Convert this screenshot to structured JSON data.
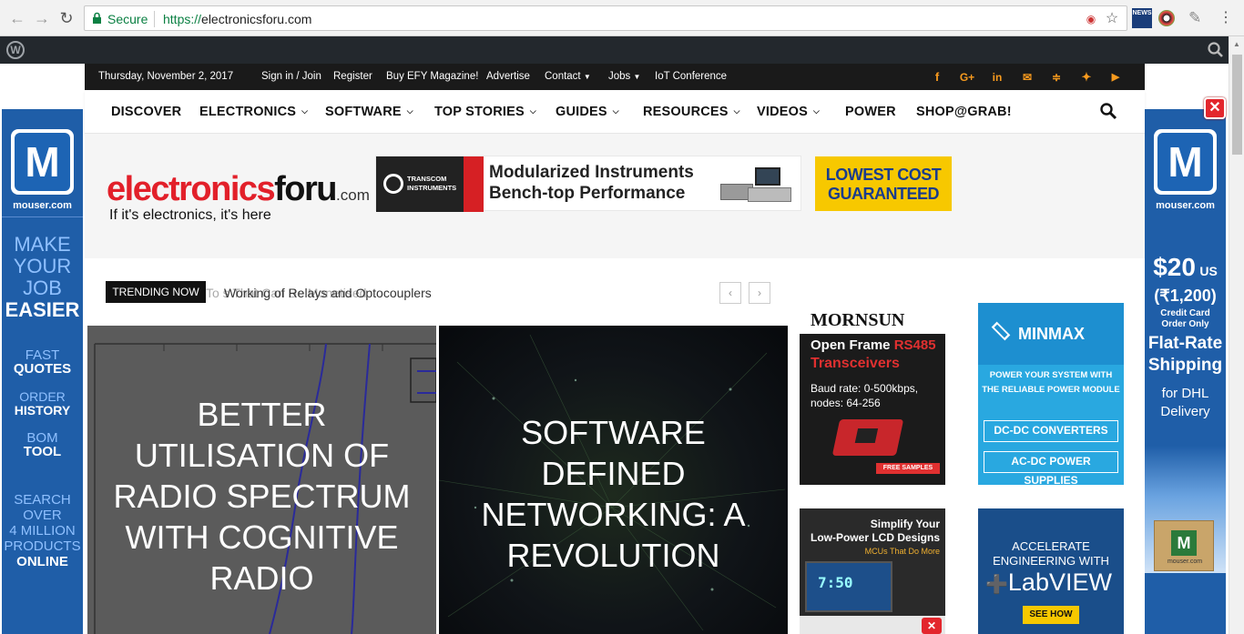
{
  "browser": {
    "secure_label": "Secure",
    "url_scheme": "https://",
    "url_host": "electronicsforu.com"
  },
  "topbar": {
    "date": "Thursday, November 2, 2017",
    "links": [
      "Sign in / Join",
      "Register",
      "Buy EFY Magazine!",
      "Advertise",
      "Contact",
      "Jobs",
      "IoT Conference"
    ]
  },
  "nav": {
    "items": [
      "DISCOVER",
      "ELECTRONICS",
      "SOFTWARE",
      "TOP STORIES",
      "GUIDES",
      "RESOURCES",
      "VIDEOS",
      "POWER",
      "SHOP@GRAB!"
    ]
  },
  "logo": {
    "red": "electronics",
    "black": "foru",
    "com": ".com",
    "tagline": "If it's electronics, it's here"
  },
  "ads": {
    "transcom": {
      "brand_1": "TRANSCOM",
      "brand_2": "INSTRUMENTS",
      "line1": "Modularized Instruments",
      "line2": "Bench-top Performance"
    },
    "lowcost": {
      "line1": "LOWEST COST",
      "line2": "GUARANTEED"
    },
    "mornsun": {
      "brand": "MORNSUN",
      "l1a": "Open Frame ",
      "l1b": "RS485",
      "l2": "Transceivers",
      "l3": "Baud rate: 0-500kbps,",
      "l4": "nodes: 64-256",
      "badge": "FREE SAMPLES"
    },
    "minmax": {
      "brand": "MINMAX",
      "l1": "POWER YOUR SYSTEM WITH",
      "l2": "THE RELIABLE POWER MODULE",
      "b1": "DC-DC CONVERTERS",
      "b2": "AC-DC POWER SUPPLIES"
    },
    "lcd": {
      "l1": "Simplify Your",
      "l2": "Low-Power LCD Designs",
      "l3": "MCUs That Do More",
      "clock": "7:50"
    },
    "labview": {
      "l1": "ACCELERATE",
      "l2": "ENGINEERING WITH",
      "brand": "LabVIEW",
      "btn": "SEE HOW"
    },
    "mouser_left": {
      "site": "mouser.com",
      "t1": "MAKE",
      "t2": "YOUR",
      "t3": "JOB",
      "t4": "EASIER",
      "f1": "FAST",
      "f2": "QUOTES",
      "o1": "ORDER",
      "o2": "HISTORY",
      "b1": "BOM",
      "b2": "TOOL",
      "s1": "SEARCH",
      "s2": "OVER",
      "s3": "4 MILLION",
      "s4": "PRODUCTS",
      "s5": "ONLINE"
    },
    "mouser_right": {
      "site": "mouser.com",
      "price": "$20",
      "cur": "US",
      "inr": "(₹1,200)",
      "c1": "Credit Card",
      "c2": "Order Only",
      "f1": "Flat-Rate",
      "f2": "Shipping",
      "f3": "for DHL",
      "f4": "Delivery",
      "box_site": "mouser.com"
    }
  },
  "trending": {
    "label": "TRENDING NOW",
    "ghost": "To                                             s That Can Be Monetised",
    "current": "Working of Relays and Optocouplers"
  },
  "heroes": [
    {
      "lines": [
        "BETTER",
        "UTILISATION OF",
        "RADIO SPECTRUM",
        "WITH COGNITIVE",
        "RADIO"
      ]
    },
    {
      "lines": [
        "SOFTWARE",
        "DEFINED",
        "NETWORKING: A",
        "REVOLUTION"
      ]
    }
  ],
  "icons": {
    "back": "back-arrow-icon",
    "forward": "forward-arrow-icon",
    "reload": "reload-icon",
    "lock": "lock-icon",
    "star": "star-icon",
    "search": "search-icon",
    "close": "close-icon",
    "social": [
      "facebook-icon",
      "google-plus-icon",
      "linkedin-icon",
      "mail-icon",
      "rss-icon",
      "twitter-icon",
      "youtube-icon"
    ]
  },
  "colors": {
    "brand_red": "#e2202a",
    "accent_orange": "#f79a1e",
    "mouser_blue": "#1f5ea8",
    "secure_green": "#0b8043"
  }
}
